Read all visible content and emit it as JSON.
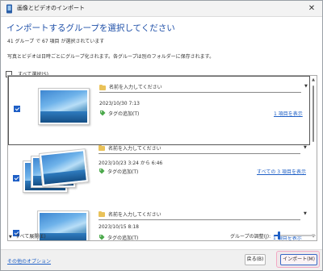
{
  "window": {
    "title": "画像とビデオのインポート",
    "close_symbol": "✕"
  },
  "main": {
    "heading": "インポートするグループを選択してください",
    "summary": "41 グループ で 67 項目 が選択されています",
    "description": "写真とビデオは日時ごとにグループ化されます。各グループは別のフォルダーに保存されます。",
    "select_all_label": "すべて選択(S)"
  },
  "groups": [
    {
      "checked": true,
      "name_placeholder": "名前を入力してください",
      "date": "2023/10/30 7:13",
      "add_tag_label": "タグの追加(T)",
      "show_link": "1 項目を表示"
    },
    {
      "checked": true,
      "name_placeholder": "名前を入力してください",
      "date": "2023/10/23 3:24 から 6:46",
      "add_tag_label": "タグの追加(T)",
      "show_link": "すべての 3 項目を表示"
    },
    {
      "checked": true,
      "name_placeholder": "名前を入力してください",
      "date": "2023/10/15 8:18",
      "add_tag_label": "タグの追加(T)",
      "show_link": "1 項目を表示"
    }
  ],
  "bottom": {
    "expand_all_label": "すべて展開(E)",
    "grouping_label": "グループの調整(J):",
    "grouping_level": 0.12
  },
  "footer": {
    "options_link": "その他のオプション",
    "back_button": "戻る(B)",
    "import_button": "インポート(M)"
  },
  "colors": {
    "accent": "#1e5fc6",
    "heading": "#1e4fa8",
    "highlight": "#f2a9c4"
  }
}
